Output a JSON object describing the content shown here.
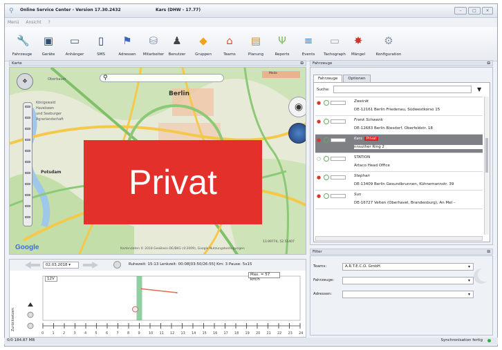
{
  "window": {
    "title_left": "Online Service Center - Version 17.30.2432",
    "title_right": "Kars (DHW - 17.77)",
    "controls": [
      "–",
      "□",
      "×"
    ]
  },
  "menu": [
    "Menü",
    "Ansicht",
    "?"
  ],
  "toolbar": {
    "items": [
      {
        "label": "Fahrzeuge",
        "icon": "wrench-icon",
        "glyph": "🔧"
      },
      {
        "label": "Geräte",
        "icon": "device-icon",
        "glyph": "▣"
      },
      {
        "label": "Anhänger",
        "icon": "trailer-icon",
        "glyph": "▭"
      },
      {
        "label": "SMS",
        "icon": "phone-icon",
        "glyph": "▯"
      },
      {
        "label": "Adressen",
        "icon": "flag-icon",
        "glyph": "⚑"
      },
      {
        "label": "Mitarbeiter",
        "icon": "staff-icon",
        "glyph": "⛁"
      },
      {
        "label": "Benutzer",
        "icon": "user-icon",
        "glyph": "♟"
      },
      {
        "label": "Gruppen",
        "icon": "tag-icon",
        "glyph": "◆"
      },
      {
        "label": "Teams",
        "icon": "house-icon",
        "glyph": "⌂"
      },
      {
        "label": "Planung",
        "icon": "clipboard-icon",
        "glyph": "▤"
      },
      {
        "label": "Reports",
        "icon": "report-icon",
        "glyph": "Ψ"
      },
      {
        "label": "Events",
        "icon": "events-icon",
        "glyph": "≡"
      },
      {
        "label": "Tachograph",
        "icon": "tachograph-icon",
        "glyph": "▭"
      },
      {
        "label": "Mängel",
        "icon": "defect-icon",
        "glyph": "✸"
      },
      {
        "label": "Konfiguration",
        "icon": "gear-icon",
        "glyph": "⚙"
      }
    ]
  },
  "map_panel": {
    "header": "Karte",
    "pin": "⊟",
    "labels": {
      "city": "Berlin",
      "potsdam": "Potsdam",
      "place1": "Königswald",
      "place2": "Havelseen",
      "place3": "und Seeburger",
      "place4": "Agrarlandschaft",
      "oberbaum": "Oberbaum"
    },
    "copyright": "Kartendaten © 2018 GeoBasis-DE/BKG (©2009), Google    Nutzungsbedingungen",
    "coordinates": "13.99774, 52.51407",
    "scale": "Meile",
    "google": "Google",
    "overlay_text": "Privat"
  },
  "chart_panel": {
    "date": "02.03.2018",
    "info": "Ruhezeit: 15:13  Lenkzeit: 00:08[03:50/26:55]  Km: 3  Pause: 5x15",
    "max_label": "Max. = 57 km/h",
    "voltage_label": "12V",
    "side_label": "Zurücksetzen"
  },
  "chart_data": {
    "type": "line",
    "categories": [
      "0",
      "1",
      "2",
      "3",
      "4",
      "5",
      "6",
      "7",
      "8",
      "9",
      "10",
      "11",
      "12",
      "13",
      "14",
      "15",
      "16",
      "17",
      "18",
      "19",
      "20",
      "21",
      "22",
      "23",
      "24"
    ],
    "series": [
      {
        "name": "speed",
        "points": [
          [
            9.2,
            57
          ],
          [
            12.5,
            50
          ]
        ]
      }
    ],
    "ylim": [
      0,
      80
    ],
    "xlim": [
      0,
      24
    ],
    "title": "",
    "xlabel": "",
    "ylabel": "",
    "highlight_hour": 9,
    "colors": {
      "speed": "#e3694a",
      "activity": "#34a853"
    }
  },
  "vehicles_panel": {
    "header": "Fahrzeuge",
    "pin": "⊟",
    "tabs": [
      "Fahrzeuge",
      "Optionen"
    ],
    "search_label": "Suche:",
    "rows": [
      {
        "name": "Zweirät",
        "address": "DE-12161 Berlin Friedenau, Südwestkorso 15",
        "selected": false
      },
      {
        "name": "Frank Schwenk",
        "address": "DE-12683 Berlin Biesdorf, Oberfeldstr. 18",
        "selected": false
      },
      {
        "name": "Kars",
        "address": "                                        nnsuther Ring 2",
        "selected": true,
        "tag": "Privat"
      },
      {
        "name": "STATION",
        "address": "Artaco Head Office",
        "selected": false
      },
      {
        "name": "Stephan",
        "address": "DE-13409 Berlin Gesundbrunnen, Kühnemannstr. 39",
        "selected": false
      },
      {
        "name": "Sun",
        "address": "DE-16727 Velten (Oberhavel, Brandenburg), An Mel –",
        "selected": false
      }
    ]
  },
  "filter_panel": {
    "header": "Filter",
    "pin": "⊟",
    "team_label": "Teams:",
    "team_value": "A.R.T.E.C.O. GmbH",
    "vehicle_label": "Fahrzeuge:",
    "vehicle_value": "",
    "address_label": "Adressen:",
    "address_value": ""
  },
  "status": {
    "memory": "0/0  184.87 MB",
    "sync": "Synchronisation fertig"
  }
}
